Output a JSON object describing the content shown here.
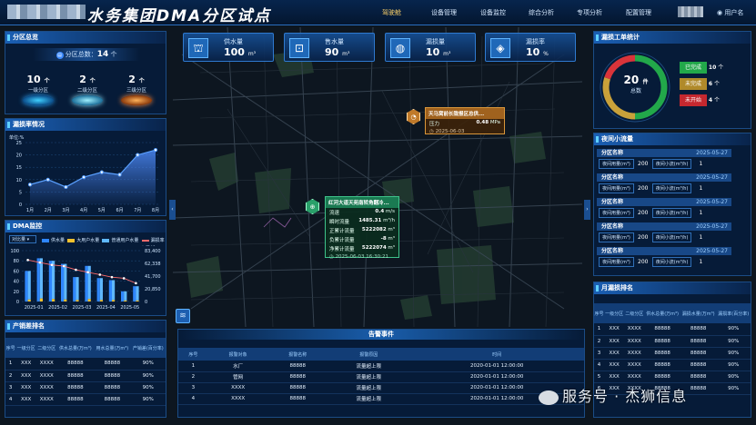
{
  "header": {
    "title": "水务集团DMA分区试点",
    "nav": [
      "驾驶舱",
      "设备管理",
      "设备监控",
      "综合分析",
      "专项分析",
      "配置管理"
    ],
    "active_nav": "驾驶舱",
    "user": "用户名"
  },
  "stats": [
    {
      "label": "供水量",
      "value": "100",
      "unit": "m³",
      "icon": "water-tower-icon"
    },
    {
      "label": "售水量",
      "value": "90",
      "unit": "m³",
      "icon": "meter-icon"
    },
    {
      "label": "漏损量",
      "value": "10",
      "unit": "m³",
      "icon": "leak-icon"
    },
    {
      "label": "漏损率",
      "value": "10",
      "unit": "%",
      "icon": "leak-rate-icon"
    }
  ],
  "zone_overview": {
    "title": "分区总览",
    "total_label": "分区总数：",
    "total": "14",
    "total_unit": "个",
    "zones": [
      {
        "count": "10",
        "unit": "个",
        "label": "一级分区"
      },
      {
        "count": "2",
        "unit": "个",
        "label": "二级分区"
      },
      {
        "count": "2",
        "unit": "个",
        "label": "三级分区"
      }
    ]
  },
  "leak_rate": {
    "title": "漏损率情况",
    "unit": "单位:%"
  },
  "dma": {
    "title": "DMA监控",
    "select": "对比量",
    "legend": [
      "供水量",
      "大用户水量",
      "普通用户水量",
      "漏损率"
    ],
    "unit": "单位:万m³"
  },
  "sales_rank": {
    "title": "产销差排名",
    "columns": [
      "序号",
      "一级分区",
      "二级分区",
      "供水总量(万m³)",
      "用水总量(万m³)",
      "产销差(百分率)"
    ],
    "rows": [
      [
        "1",
        "XXX",
        "XXXX",
        "88888",
        "88888",
        "90%"
      ],
      [
        "2",
        "XXX",
        "XXXX",
        "88888",
        "88888",
        "90%"
      ],
      [
        "3",
        "XXX",
        "XXXX",
        "88888",
        "88888",
        "90%"
      ],
      [
        "4",
        "XXX",
        "XXXX",
        "88888",
        "88888",
        "90%"
      ]
    ]
  },
  "popup_a": {
    "title": "天马窝前长陇报区总供...",
    "label": "压力",
    "value": "0.48",
    "unit": "MPa",
    "time": "2025-06-03"
  },
  "popup_b": {
    "title": "红河大道天苑南转角翻冷...",
    "rows": [
      [
        "流速",
        "0.4",
        "m/s"
      ],
      [
        "瞬时流量",
        "1485.31",
        "m³/h"
      ],
      [
        "正累计流量",
        "5222082",
        "m³"
      ],
      [
        "负累计流量",
        "-8",
        "m³"
      ],
      [
        "净累计流量",
        "5222074",
        "m³"
      ]
    ],
    "time": "2025-06-03 16:30:21"
  },
  "alarms": {
    "title": "告警事件",
    "columns": [
      "序号",
      "报警对象",
      "报警名称",
      "报警原因",
      "时间"
    ],
    "rows": [
      [
        "1",
        "水厂",
        "88888",
        "流量超上限",
        "2020-01-01 12:00:00"
      ],
      [
        "2",
        "管网",
        "88888",
        "流量超上限",
        "2020-01-01 12:00:00"
      ],
      [
        "3",
        "XXXX",
        "88888",
        "流量超上限",
        "2020-01-01 12:00:00"
      ],
      [
        "4",
        "XXXX",
        "88888",
        "流量超上限",
        "2020-01-01 12:00:00"
      ]
    ]
  },
  "work_orders": {
    "title": "漏损工单统计",
    "total": "20",
    "total_unit": "件",
    "total_label": "总数",
    "items": [
      {
        "label": "已完成",
        "value": "10",
        "unit": "个",
        "color": "#22a84a"
      },
      {
        "label": "未完成",
        "value": "6",
        "unit": "个",
        "color": "#c9a13a"
      },
      {
        "label": "未开始",
        "value": "4",
        "unit": "个",
        "color": "#d9343a"
      }
    ]
  },
  "night_flow": {
    "title": "夜间小流量",
    "rows": [
      {
        "name": "分区名称",
        "date": "2025-05-27",
        "l1": "夜间用量(m³)",
        "v1": "200",
        "l2": "夜间小流(m³/h)",
        "v2": "1"
      },
      {
        "name": "分区名称",
        "date": "2025-05-27",
        "l1": "夜间用量(m³)",
        "v1": "200",
        "l2": "夜间小流(m³/h)",
        "v2": "1"
      },
      {
        "name": "分区名称",
        "date": "2025-05-27",
        "l1": "夜间用量(m³)",
        "v1": "200",
        "l2": "夜间小流(m³/h)",
        "v2": "1"
      },
      {
        "name": "分区名称",
        "date": "2025-05-27",
        "l1": "夜间用量(m³)",
        "v1": "200",
        "l2": "夜间小流(m³/h)",
        "v2": "1"
      },
      {
        "name": "分区名称",
        "date": "2025-05-27",
        "l1": "夜间用量(m³)",
        "v1": "200",
        "l2": "夜间小流(m³/h)",
        "v2": "1"
      }
    ]
  },
  "month_rank": {
    "title": "月漏损排名",
    "columns": [
      "序号",
      "一级分区",
      "二级分区",
      "供水总量(万m³)",
      "漏损水量(万m³)",
      "漏损率(百分率)"
    ],
    "rows": [
      [
        "1",
        "XXX",
        "XXXX",
        "88888",
        "88888",
        "90%"
      ],
      [
        "2",
        "XXX",
        "XXXX",
        "88888",
        "88888",
        "90%"
      ],
      [
        "3",
        "XXX",
        "XXXX",
        "88888",
        "88888",
        "90%"
      ],
      [
        "4",
        "XXX",
        "XXXX",
        "88888",
        "88888",
        "90%"
      ],
      [
        "5",
        "XXX",
        "XXXX",
        "88888",
        "88888",
        "90%"
      ],
      [
        "6",
        "XXX",
        "XXXX",
        "88888",
        "88888",
        "90%"
      ]
    ]
  },
  "watermark": "服务号 · 杰狮信息",
  "chart_data": [
    {
      "type": "area",
      "x": [
        "1月",
        "2月",
        "3月",
        "4月",
        "5月",
        "6月",
        "7月",
        "8月"
      ],
      "values": [
        8,
        10,
        7,
        11,
        13,
        12,
        20,
        22
      ],
      "ylim": [
        0,
        25
      ],
      "yticks": [
        0,
        5,
        10,
        15,
        20,
        25
      ],
      "ylabel": "单位:%",
      "grid": true,
      "color": "#5aa0ff"
    },
    {
      "type": "bar",
      "categories": [
        "2025-01",
        "2025-02",
        "2025-03",
        "2025-04",
        "2025-05"
      ],
      "series": [
        {
          "name": "供水量",
          "values": [
            60,
            85,
            80,
            74,
            48,
            70,
            46,
            42,
            20,
            30
          ],
          "color": "#2e86ff"
        },
        {
          "name": "大用户水量",
          "values": [
            4,
            6,
            5,
            4,
            3,
            5,
            3,
            3,
            2,
            2
          ],
          "color": "#f2c12e"
        },
        {
          "name": "普通用户水量",
          "values": [
            56,
            79,
            75,
            70,
            45,
            65,
            43,
            39,
            18,
            28
          ],
          "color": "#5fb8ff"
        },
        {
          "name": "漏损率",
          "values": [
            68000,
            64000,
            60000,
            58000,
            52000,
            48000,
            44000,
            40000,
            38000,
            30000
          ],
          "color": "#ff6b6b"
        }
      ],
      "ylim": [
        0,
        100
      ],
      "yticks": [
        0,
        20,
        40,
        60,
        80,
        100
      ],
      "ylim_right": [
        0,
        83400
      ],
      "yticks_right": [
        "0",
        "20,850",
        "41,700",
        "62,338",
        "83,400"
      ],
      "ylabel_right": "单位:万m³",
      "grid": true
    }
  ]
}
